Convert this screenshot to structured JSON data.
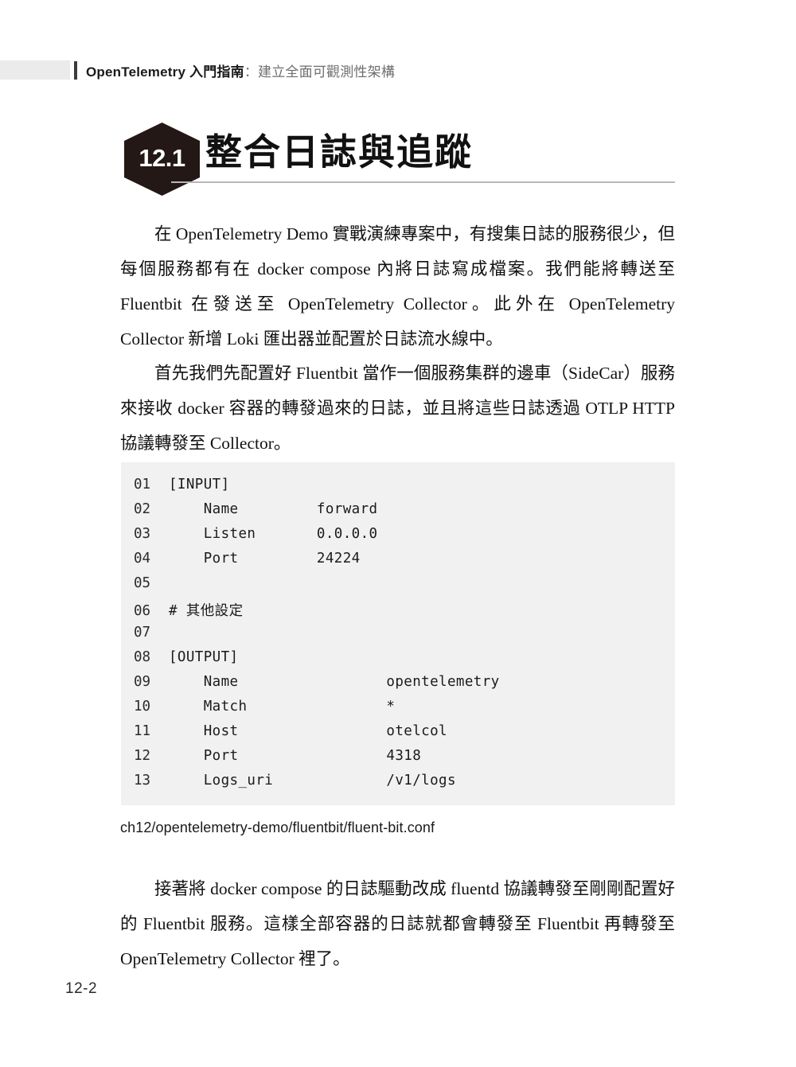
{
  "running_head": {
    "title_strong": "OpenTelemetry 入門指南",
    "title_sub": "：建立全面可觀測性架構"
  },
  "section": {
    "number": "12.1",
    "title": "整合日誌與追蹤"
  },
  "paragraphs": {
    "p1": "在 OpenTelemetry Demo 實戰演練專案中，有搜集日誌的服務很少，但每個服務都有在 docker compose 內將日誌寫成檔案。我們能將轉送至 Fluentbit 在發送至 OpenTelemetry Collector。此外在 OpenTelemetry Collector 新增 Loki 匯出器並配置於日誌流水線中。",
    "p2": "首先我們先配置好 Fluentbit 當作一個服務集群的邊車（SideCar）服務來接收 docker 容器的轉發過來的日誌，並且將這些日誌透過 OTLP HTTP 協議轉發至 Collector。",
    "p3": "接著將 docker compose 的日誌驅動改成 fluentd 協議轉發至剛剛配置好的 Fluentbit 服務。這樣全部容器的日誌就都會轉發至 Fluentbit 再轉發至 OpenTelemetry Collector 裡了。"
  },
  "code_block": {
    "lines": [
      {
        "no": "01",
        "text": "[INPUT]"
      },
      {
        "no": "02",
        "text": "    Name         forward"
      },
      {
        "no": "03",
        "text": "    Listen       0.0.0.0"
      },
      {
        "no": "04",
        "text": "    Port         24224"
      },
      {
        "no": "05",
        "text": ""
      },
      {
        "no": "06",
        "text": "# 其他設定"
      },
      {
        "no": "07",
        "text": ""
      },
      {
        "no": "08",
        "text": "[OUTPUT]"
      },
      {
        "no": "09",
        "text": "    Name                 opentelemetry"
      },
      {
        "no": "10",
        "text": "    Match                *"
      },
      {
        "no": "11",
        "text": "    Host                 otelcol"
      },
      {
        "no": "12",
        "text": "    Port                 4318"
      },
      {
        "no": "13",
        "text": "    Logs_uri             /v1/logs"
      }
    ]
  },
  "caption": "ch12/opentelemetry-demo/fluentbit/fluent-bit.conf",
  "folio": "12-2",
  "colors": {
    "badge": "#231815",
    "code_bg": "#f1f1f1",
    "rule": "#b7b7b7",
    "runhead_block": "#ebebeb",
    "runhead_sub_text": "#6e6e6e"
  }
}
